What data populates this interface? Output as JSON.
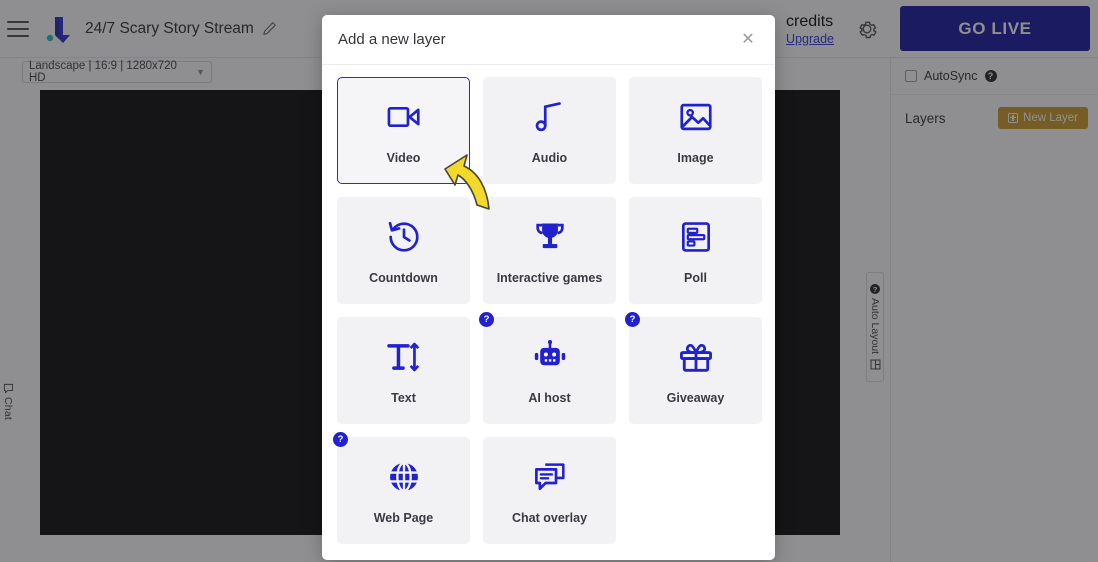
{
  "header": {
    "menu_icon": "hamburger-menu-icon",
    "logo_icon": "app-logo-icon",
    "stream_title": "24/7 Scary Story Stream",
    "edit_icon": "pencil-edit-icon",
    "credits_label": "credits",
    "upgrade_label": "Upgrade",
    "settings_icon": "gear-icon",
    "go_live_label": "GO LIVE"
  },
  "subbar": {
    "aspect_value": "Landscape | 16:9 | 1280x720 HD",
    "caret_icon": "chevron-down-icon"
  },
  "editor": {
    "chat_tab_label": "Chat",
    "chat_tab_icon": "chat-bubble-icon"
  },
  "right_panel": {
    "autosync_label": "AutoSync",
    "autosync_help_icon": "help-question-icon",
    "autosync_checked": false,
    "layers_label": "Layers",
    "new_layer_label": "New Layer",
    "new_layer_icon": "plus-square-icon",
    "new_layer_color": "#c9961f",
    "auto_layout_label": "Auto Layout",
    "auto_layout_help_icon": "help-question-icon",
    "auto_layout_grid_icon": "layout-grid-icon"
  },
  "modal": {
    "title": "Add a new layer",
    "close_icon": "close-icon",
    "cards": [
      {
        "label": "Video",
        "icon": "video-camera-icon",
        "badge": null,
        "selected": true
      },
      {
        "label": "Audio",
        "icon": "music-note-icon",
        "badge": null,
        "selected": false
      },
      {
        "label": "Image",
        "icon": "image-icon",
        "badge": null,
        "selected": false
      },
      {
        "label": "Countdown",
        "icon": "clock-rewind-icon",
        "badge": null,
        "selected": false
      },
      {
        "label": "Interactive games",
        "icon": "trophy-icon",
        "badge": null,
        "selected": false
      },
      {
        "label": "Poll",
        "icon": "poll-bars-icon",
        "badge": null,
        "selected": false
      },
      {
        "label": "Text",
        "icon": "text-size-icon",
        "badge": null,
        "selected": false
      },
      {
        "label": "AI host",
        "icon": "robot-icon",
        "badge": "?",
        "selected": false
      },
      {
        "label": "Giveaway",
        "icon": "gift-icon",
        "badge": "?",
        "selected": false
      },
      {
        "label": "Web Page",
        "icon": "globe-icon",
        "badge": "?",
        "selected": false
      },
      {
        "label": "Chat overlay",
        "icon": "chat-overlay-icon",
        "badge": null,
        "selected": false
      }
    ]
  },
  "annotation": {
    "cursor_icon": "yellow-cursor-arrow",
    "color": "#f2d92b"
  },
  "colors": {
    "brand_blue": "#2222cc",
    "go_live": "#0d0d9e",
    "accent_gold": "#c9961f",
    "card_bg": "#f2f2f5"
  }
}
